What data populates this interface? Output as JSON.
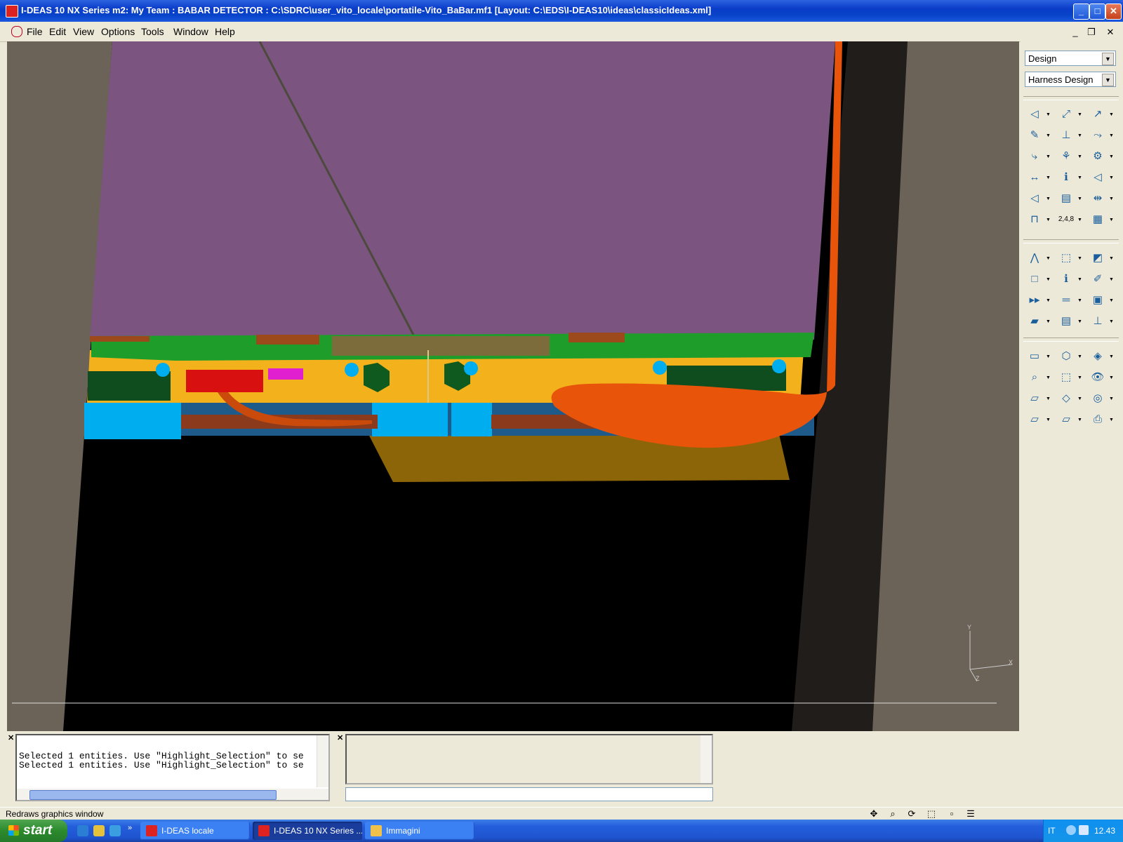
{
  "window": {
    "title": "I-DEAS 10 NX Series m2:    My Team : BABAR DETECTOR : C:\\SDRC\\user_vito_locale\\portatile-Vito_BaBar.mf1    [Layout: C:\\EDS\\I-DEAS10\\ideas\\classicIdeas.xml]",
    "controls": {
      "minimize": "_",
      "maximize": "□",
      "close": "✕"
    }
  },
  "menu": {
    "items": [
      "File",
      "Edit",
      "View",
      "Options",
      "Tools",
      "Window",
      "Help"
    ],
    "mdi": {
      "minimize": "_",
      "restore": "❐",
      "close": "✕"
    }
  },
  "panel": {
    "application": "Design",
    "task": "Harness Design",
    "tool_groups": [
      [
        "route-icon",
        "connector-icon",
        "branch-icon",
        "terminal-icon",
        "wire-icon",
        "splice-icon",
        "path-icon",
        "bundle-icon",
        "clip-icon",
        "dimension-icon",
        "info-icon",
        "tag-icon",
        "segment-icon",
        "bom-icon",
        "length-icon",
        "frame-icon",
        "numbering-icon",
        "report-icon"
      ],
      [
        "node-icon",
        "box-select-icon",
        "shape-icon",
        "rectangle-icon",
        "info-i-icon",
        "paint-icon",
        "arrows-icon",
        "measure-icon",
        "container-icon",
        "eraser-icon",
        "options-icon",
        "pin-icon"
      ],
      [
        "display-icon",
        "wireframe-icon",
        "shaded-icon",
        "zoom-all-icon",
        "zoom-box-icon",
        "view-eye-icon",
        "view-zx-icon",
        "isometric-icon",
        "hidden-icon",
        "view-yx-icon",
        "view-yz-icon",
        "print-icon"
      ]
    ]
  },
  "axes": {
    "y": "Y",
    "x": "X",
    "z": "Z"
  },
  "log": {
    "lines": [
      "Selected 1 entities.  Use \"Highlight_Selection\" to se",
      "Selected 1 entities.  Use \"Highlight_Selection\" to se"
    ]
  },
  "status": {
    "message": "Redraws graphics window"
  },
  "taskbar": {
    "start_label": "start",
    "tasks": [
      {
        "label": "I-DEAS locale",
        "active": false
      },
      {
        "label": "I-DEAS 10 NX Series ...",
        "active": true
      },
      {
        "label": "Immagini",
        "active": false
      }
    ],
    "tray": {
      "language": "IT",
      "clock": "12.43"
    }
  },
  "colors": {
    "viewport_background": "#000000",
    "panel_purple": "#7b5480",
    "cable_orange": "#e8540a",
    "board_yellow": "#f3b21c",
    "board_green": "#1f9d2a",
    "cyan_block": "#00aeef",
    "gold_plate": "#8c6508",
    "wall_gray": "#6b6258"
  }
}
